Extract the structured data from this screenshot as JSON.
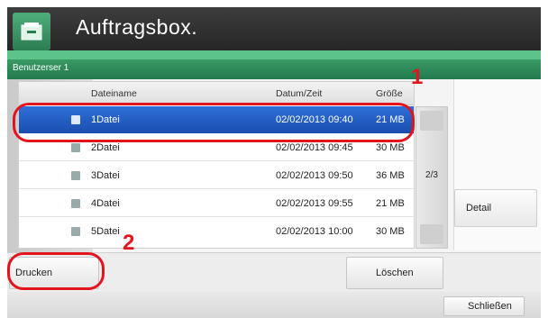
{
  "header": {
    "title": "Auftragsbox."
  },
  "user_bar": {
    "label": "Benutzerser 1"
  },
  "table": {
    "columns": {
      "name": "Dateiname",
      "date": "Datum/Zeit",
      "size": "Größe"
    },
    "rows": [
      {
        "name": "1Datei",
        "date": "02/02/2013 09:40",
        "size": "21 MB",
        "selected": true
      },
      {
        "name": "2Datei",
        "date": "02/02/2013 09:45",
        "size": "30 MB",
        "selected": false
      },
      {
        "name": "3Datei",
        "date": "02/02/2013 09:50",
        "size": "36 MB",
        "selected": false
      },
      {
        "name": "4Datei",
        "date": "02/02/2013 09:55",
        "size": "21 MB",
        "selected": false
      },
      {
        "name": "5Datei",
        "date": "02/02/2013 10:00",
        "size": "30 MB",
        "selected": false
      }
    ]
  },
  "pager": {
    "indicator": "2/3"
  },
  "buttons": {
    "detail": "Detail",
    "print": "Drucken",
    "delete": "Löschen",
    "close": "Schließen"
  },
  "callouts": {
    "one": "1",
    "two": "2"
  },
  "colors": {
    "header_bg": "#2e2e2e",
    "accent_green": "#2a8a57",
    "selection_blue": "#1f5bc4",
    "callout_red": "#e4141f"
  },
  "icons": [
    "box-icon",
    "file-icon",
    "checkbox-icon"
  ]
}
